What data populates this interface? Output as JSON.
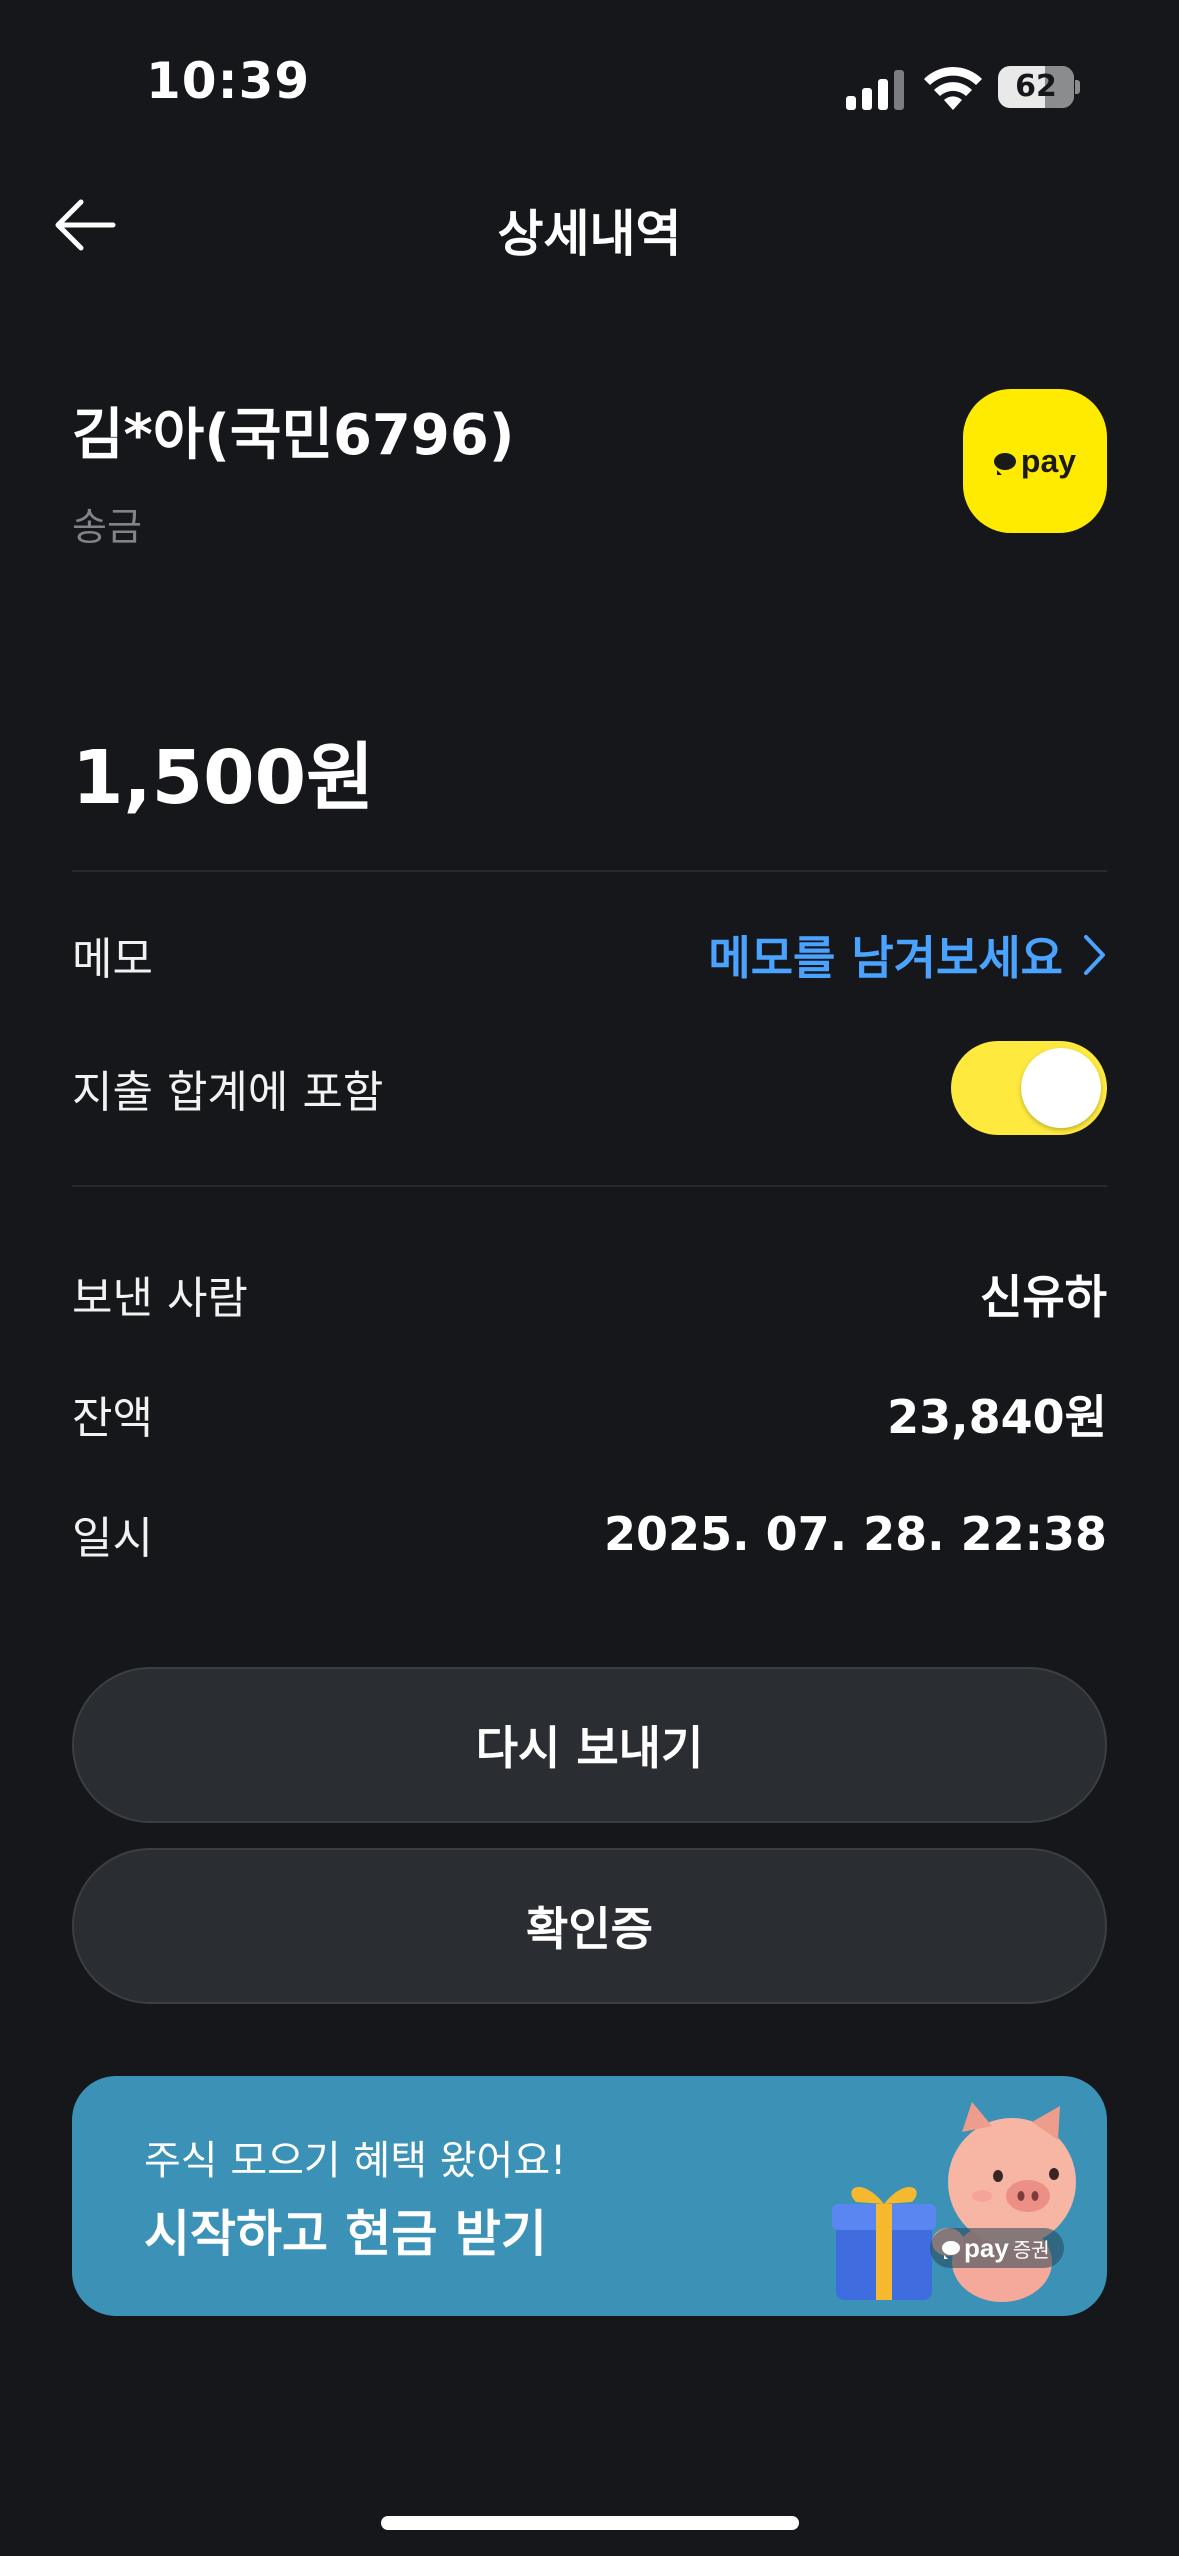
{
  "status_bar": {
    "time": "10:39",
    "battery_level": "62",
    "battery_fraction": 0.62
  },
  "nav": {
    "title": "상세내역",
    "back_icon": "arrow-left-icon"
  },
  "transaction": {
    "counterparty": "김*아(국민6796)",
    "type": "송금",
    "provider_logo": "pay",
    "amount": "1,500원"
  },
  "memo": {
    "label": "메모",
    "link_text": "메모를 남겨보세요"
  },
  "include_total": {
    "label": "지출 합계에 포함",
    "enabled": true
  },
  "details": [
    {
      "label": "보낸 사람",
      "value": "신유하"
    },
    {
      "label": "잔액",
      "value": "23,840원"
    },
    {
      "label": "일시",
      "value": "2025. 07. 28. 22:38"
    }
  ],
  "buttons": {
    "resend": "다시 보내기",
    "receipt": "확인증"
  },
  "banner": {
    "subtitle": "주식 모으기 혜택 왔어요!",
    "title": "시작하고 현금 받기",
    "badge_pay": "pay",
    "badge_label": "증권"
  },
  "colors": {
    "background": "#15171a",
    "accent_link": "#4aa3ff",
    "toggle_on": "#fee93f",
    "pay_yellow": "#ffeb00",
    "banner_bg": "#3b92b6"
  }
}
